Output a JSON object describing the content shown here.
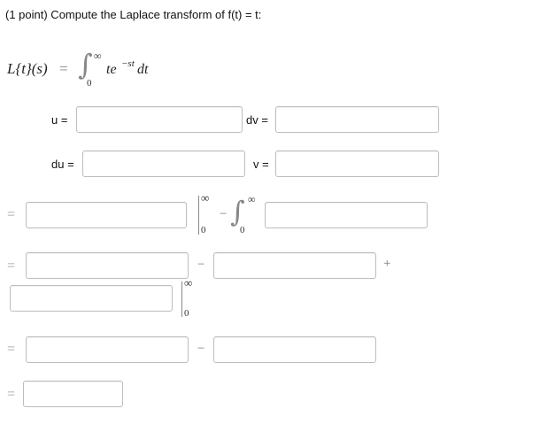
{
  "problem": {
    "header": "(1 point) Compute the Laplace transform of f(t) = t:"
  },
  "formula": {
    "lhs": "L{t}(s)",
    "eq": "=",
    "int_sym": "∫",
    "upper": "∞",
    "lower": "0",
    "integrand_te": "te",
    "exponent": "−st",
    "dt": "dt"
  },
  "labels": {
    "u": "u =",
    "dv": "dv =",
    "du": "du =",
    "v": "v ="
  },
  "symbols": {
    "eq": "=",
    "minus": "−",
    "plus": "+",
    "inf": "∞",
    "zero": "0",
    "integral": "∫"
  }
}
